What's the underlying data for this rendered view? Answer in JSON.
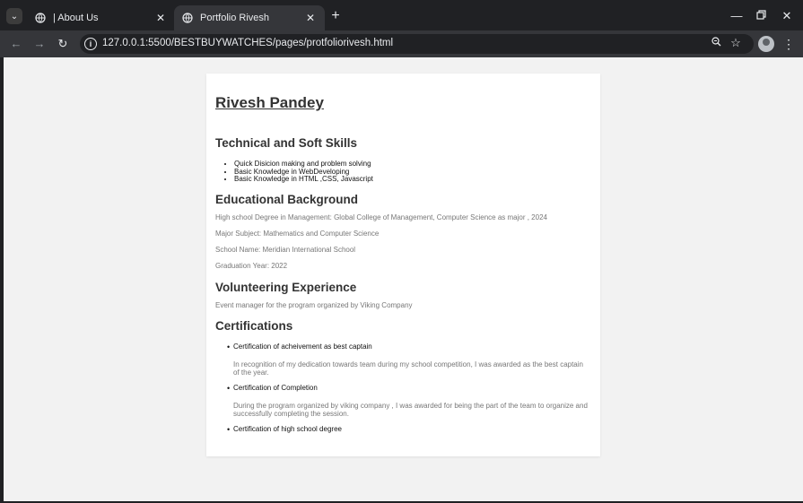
{
  "browser": {
    "tabs": [
      {
        "title": "| About Us",
        "active": false
      },
      {
        "title": "Portfolio Rivesh",
        "active": true
      }
    ],
    "url": "127.0.0.1:5500/BESTBUYWATCHES/pages/protfoliorivesh.html"
  },
  "page": {
    "name": "Rivesh Pandey",
    "skills_heading": "Technical and Soft Skills",
    "skills": [
      "Quick Disicion making and problem solving",
      "Basic Knowledge in WebDeveloping",
      "Basic Knowledge in HTML ,CSS, Javascript"
    ],
    "education_heading": "Educational Background",
    "education": [
      "High school Degree in Management: Global College of Management, Computer Science as major , 2024",
      "Major Subject: Mathematics and Computer Science",
      "School Name: Meridian International School",
      "Graduation Year: 2022"
    ],
    "volunteering_heading": "Volunteering Experience",
    "volunteering": "Event manager for the program organized by Viking Company",
    "certifications_heading": "Certifications",
    "certifications": [
      {
        "title": "Certification of acheivement as best captain",
        "description": "In recognition of my dedication towards team during my school competition, I was awarded as the best captain of the year."
      },
      {
        "title": "Certification of Completion",
        "description": "During the program organized by viking company , I was awarded for being the part of the team to organize and successfully completing the session."
      },
      {
        "title": "Certification of high school degree",
        "description": ""
      }
    ]
  }
}
